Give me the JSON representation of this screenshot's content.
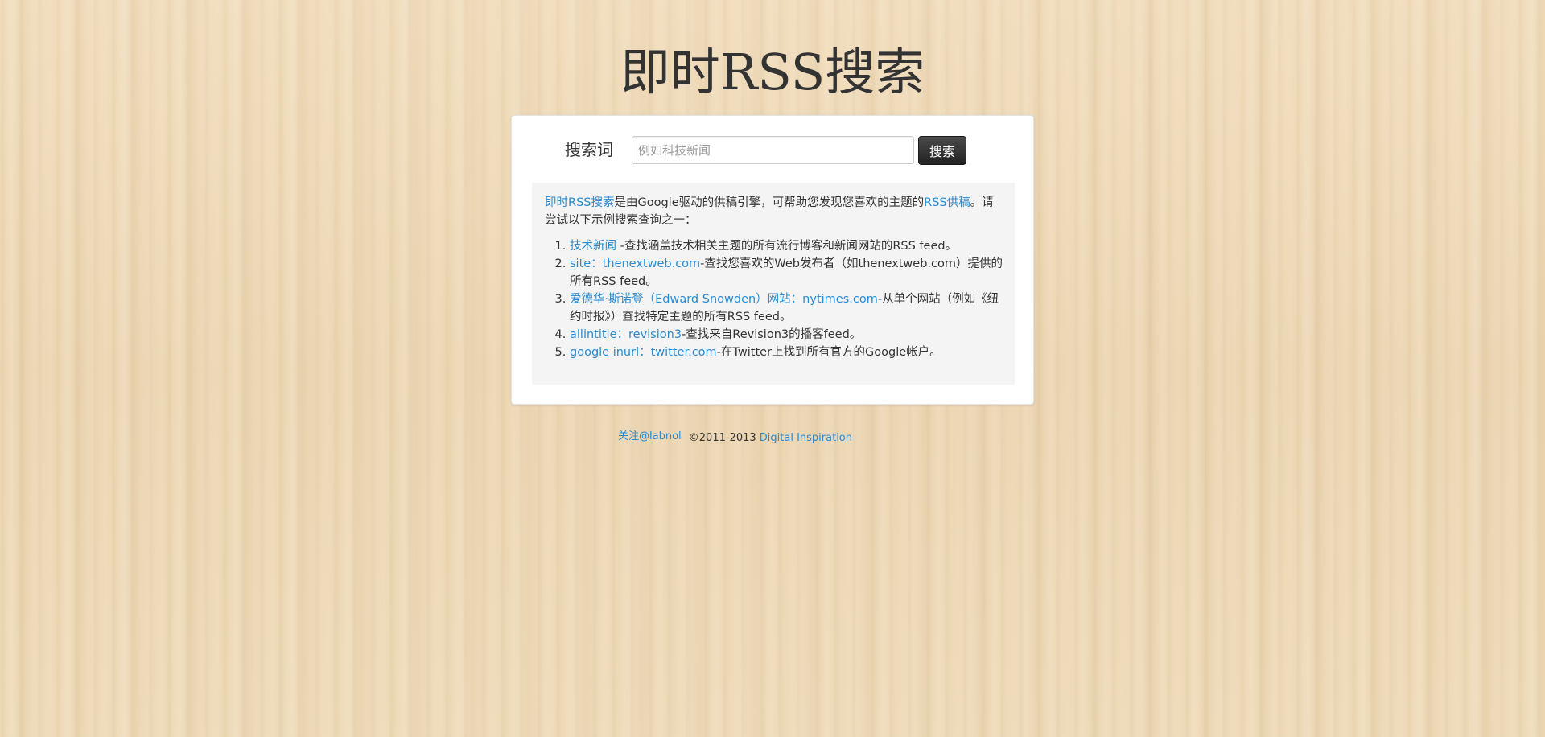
{
  "page": {
    "title": "即时RSS搜索"
  },
  "search": {
    "label": "搜索词",
    "placeholder": "例如科技新闻",
    "value": "",
    "button_label": "搜索"
  },
  "info": {
    "intro_link": "即时RSS搜索",
    "intro_text": "是由Google驱动的供稿引擎，可帮助您发现您喜欢的主题的",
    "rss_link": "RSS供稿",
    "intro_end": "。请尝试以下示例搜索查询之一：",
    "examples": [
      {
        "query": "技术新闻",
        "desc": " -查找涵盖技术相关主题的所有流行博客和新闻网站的RSS feed。"
      },
      {
        "query": "site：thenextweb.com",
        "desc": "-查找您喜欢的Web发布者（如thenextweb.com）提供的所有RSS feed。"
      },
      {
        "query": "爱德华·斯诺登（Edward Snowden）网站：nytimes.com",
        "desc": "-从单个网站（例如《纽约时报》）查找特定主题的所有RSS feed。"
      },
      {
        "query": "allintitle：revision3",
        "desc": "-查找来自Revision3的播客feed。"
      },
      {
        "query": "google inurl：twitter.com",
        "desc": "-在Twitter上找到所有官方的Google帐户。"
      }
    ]
  },
  "footer": {
    "follow_link": "关注@labnol",
    "copyright": "©2011-2013",
    "brand_link": "Digital Inspiration"
  },
  "colors": {
    "link": "#2a8bd0",
    "button": "#333333",
    "panel": "#f4f4f4"
  }
}
